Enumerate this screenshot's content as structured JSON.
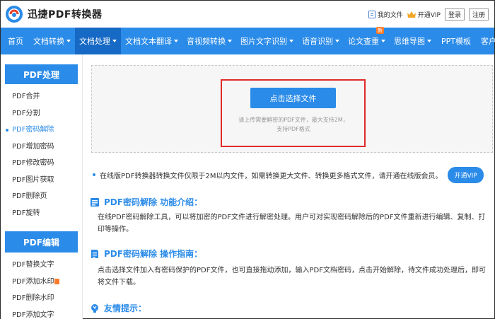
{
  "header": {
    "brand": "迅捷PDF转换器",
    "my_files": "我的文件",
    "open_vip": "开通VIP",
    "login": "登录",
    "register": "注册"
  },
  "nav": {
    "items": [
      "首页",
      "文档转换",
      "文档处理",
      "文档文本翻译",
      "音视频转换",
      "图片文字识别",
      "语音识别",
      "论文查重",
      "思维导图",
      "PPT模板",
      "客户端"
    ],
    "new_badge": "新"
  },
  "sidebar": {
    "section1": "PDF处理",
    "items1": [
      "PDF合并",
      "PDF分割",
      "PDF密码解除",
      "PDF增加密码",
      "PDF修改密码",
      "PDF图片获取",
      "PDF删除页",
      "PDF旋转"
    ],
    "section2": "PDF编辑",
    "items2": [
      "PDF替换文字",
      "PDF添加水印",
      "PDF删除水印",
      "PDF添加文字"
    ]
  },
  "upload": {
    "button": "点击选择文件",
    "tip_line1": "请上传需要解密的PDF文件，最大支持2M，",
    "tip_line2": "支持PDF格式"
  },
  "notice": {
    "text": "在线版PDF转换器转换文件仅限于2M以内文件，如需转换更大文件、转换更多格式文件，请开通在线版会员。",
    "vip_button": "开通VIP"
  },
  "sections": {
    "intro_title": "PDF密码解除 功能介绍：",
    "intro_text": "在线PDF密码解除工具，可以将加密的PDF文件进行解密处理。用户可对实现密码解除后的PDF文件重新进行编辑、复制、打印等操作。",
    "guide_title": "PDF密码解除 操作指南：",
    "guide_text": "点击选择文件加入有密码保护的PDF文件，也可直接拖动添加，输入PDF文档密码，点击开始解除，待文件成功处理后，即可将文件下载。",
    "tips_title": "友情提示："
  },
  "colors": {
    "primary": "#2b8be8",
    "nav_active": "#1669c4",
    "highlight_box": "#e02a2a",
    "badge": "#ff7a2a"
  }
}
